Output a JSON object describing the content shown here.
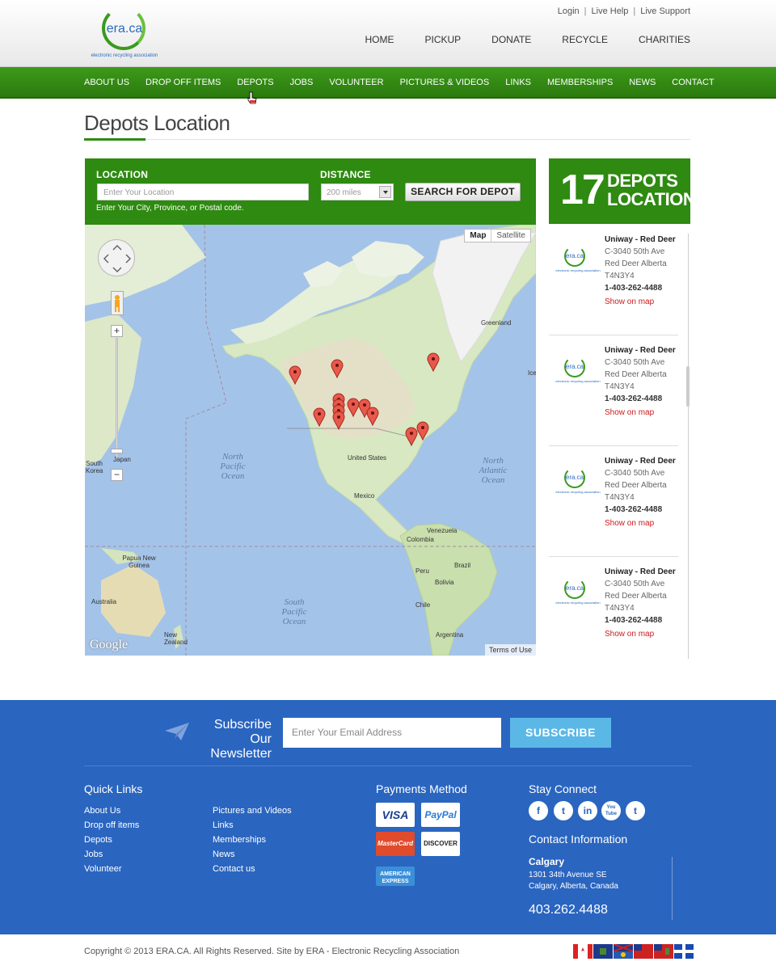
{
  "header": {
    "logo_text": "era.ca",
    "logo_subtext": "electronic recycling association",
    "top_links": [
      "Login",
      "Live Help",
      "Live Support"
    ],
    "main_nav": [
      "HOME",
      "PICKUP",
      "DONATE",
      "RECYCLE",
      "CHARITIES"
    ]
  },
  "sub_nav": [
    "ABOUT US",
    "DROP OFF ITEMS",
    "DEPOTS",
    "JOBS",
    "VOLUNTEER",
    "PICTURES & VIDEOS",
    "LINKS",
    "MEMBERSHIPS",
    "NEWS",
    "CONTACT"
  ],
  "page": {
    "title": "Depots Location"
  },
  "search": {
    "location_label": "LOCATION",
    "location_placeholder": "Enter Your Location",
    "hint": "Enter Your City, Province, or Postal code.",
    "distance_label": "DISTANCE",
    "distance_value": "200 miles",
    "button": "SEARCH FOR DEPOT"
  },
  "map": {
    "type_map": "Map",
    "type_satellite": "Satellite",
    "labels": {
      "greenland": "Greenland",
      "iceland": "Ice",
      "united_states": "United States",
      "mexico": "Mexico",
      "venezuela": "Venezuela",
      "colombia": "Colombia",
      "peru": "Peru",
      "brazil": "Brazil",
      "bolivia": "Bolivia",
      "chile": "Chile",
      "argentina": "Argentina",
      "japan": "Japan",
      "south_korea": "South Korea",
      "papua": "Papua New Guinea",
      "australia": "Australia",
      "new_zealand": "New Zealand"
    },
    "oceans": {
      "north_pacific": "North Pacific Ocean",
      "north_atlantic": "North Atlantic Ocean",
      "south_pacific": "South Pacific Ocean"
    },
    "google": "Google",
    "terms": "Terms of Use"
  },
  "depots": {
    "count": "17",
    "word1": "DEPOTS",
    "word2": "LOCATION",
    "items": [
      {
        "name": "Uniway - Red Deer",
        "street": "C-3040 50th Ave",
        "city": "Red Deer Alberta",
        "postal": "T4N3Y4",
        "phone": "1-403-262-4488",
        "link": "Show on map"
      },
      {
        "name": "Uniway - Red Deer",
        "street": "C-3040 50th Ave",
        "city": "Red Deer Alberta",
        "postal": "T4N3Y4",
        "phone": "1-403-262-4488",
        "link": "Show on map"
      },
      {
        "name": "Uniway - Red Deer",
        "street": "C-3040 50th Ave",
        "city": "Red Deer Alberta",
        "postal": "T4N3Y4",
        "phone": "1-403-262-4488",
        "link": "Show on map"
      },
      {
        "name": "Uniway - Red Deer",
        "street": "C-3040 50th Ave",
        "city": "Red Deer Alberta",
        "postal": "T4N3Y4",
        "phone": "1-403-262-4488",
        "link": "Show on map"
      }
    ]
  },
  "newsletter": {
    "title_line1": "Subscribe Our",
    "title_line2": "Newsletter",
    "placeholder": "Enter Your Email Address",
    "button": "SUBSCRIBE"
  },
  "footer": {
    "quick_links_title": "Quick Links",
    "quick_links_col1": [
      "About Us",
      "Drop off items",
      "Depots",
      "Jobs",
      "Volunteer"
    ],
    "quick_links_col2": [
      "Pictures and Videos",
      "Links",
      "Memberships",
      "News",
      "Contact us"
    ],
    "payments_title": "Payments Method",
    "cards": [
      "VISA",
      "PayPal",
      "MasterCard",
      "DISCOVER",
      "AMERICAN EXPRESS"
    ],
    "stay_title": "Stay Connect",
    "social": [
      "f",
      "t",
      "in",
      "You Tube",
      "t"
    ],
    "contact_title": "Contact Information",
    "city": "Calgary",
    "address1": "1301 34th Avenue SE",
    "address2": "Calgary, Alberta, Canada",
    "phone": "403.262.4488"
  },
  "copyright": "Copyright © 2013 ERA.CA. All Rights Reserved. Site by ERA - Electronic Recycling Association",
  "colors": {
    "green": "#2e8a10",
    "blue": "#2a65c0",
    "link_red": "#cc1a1a"
  }
}
